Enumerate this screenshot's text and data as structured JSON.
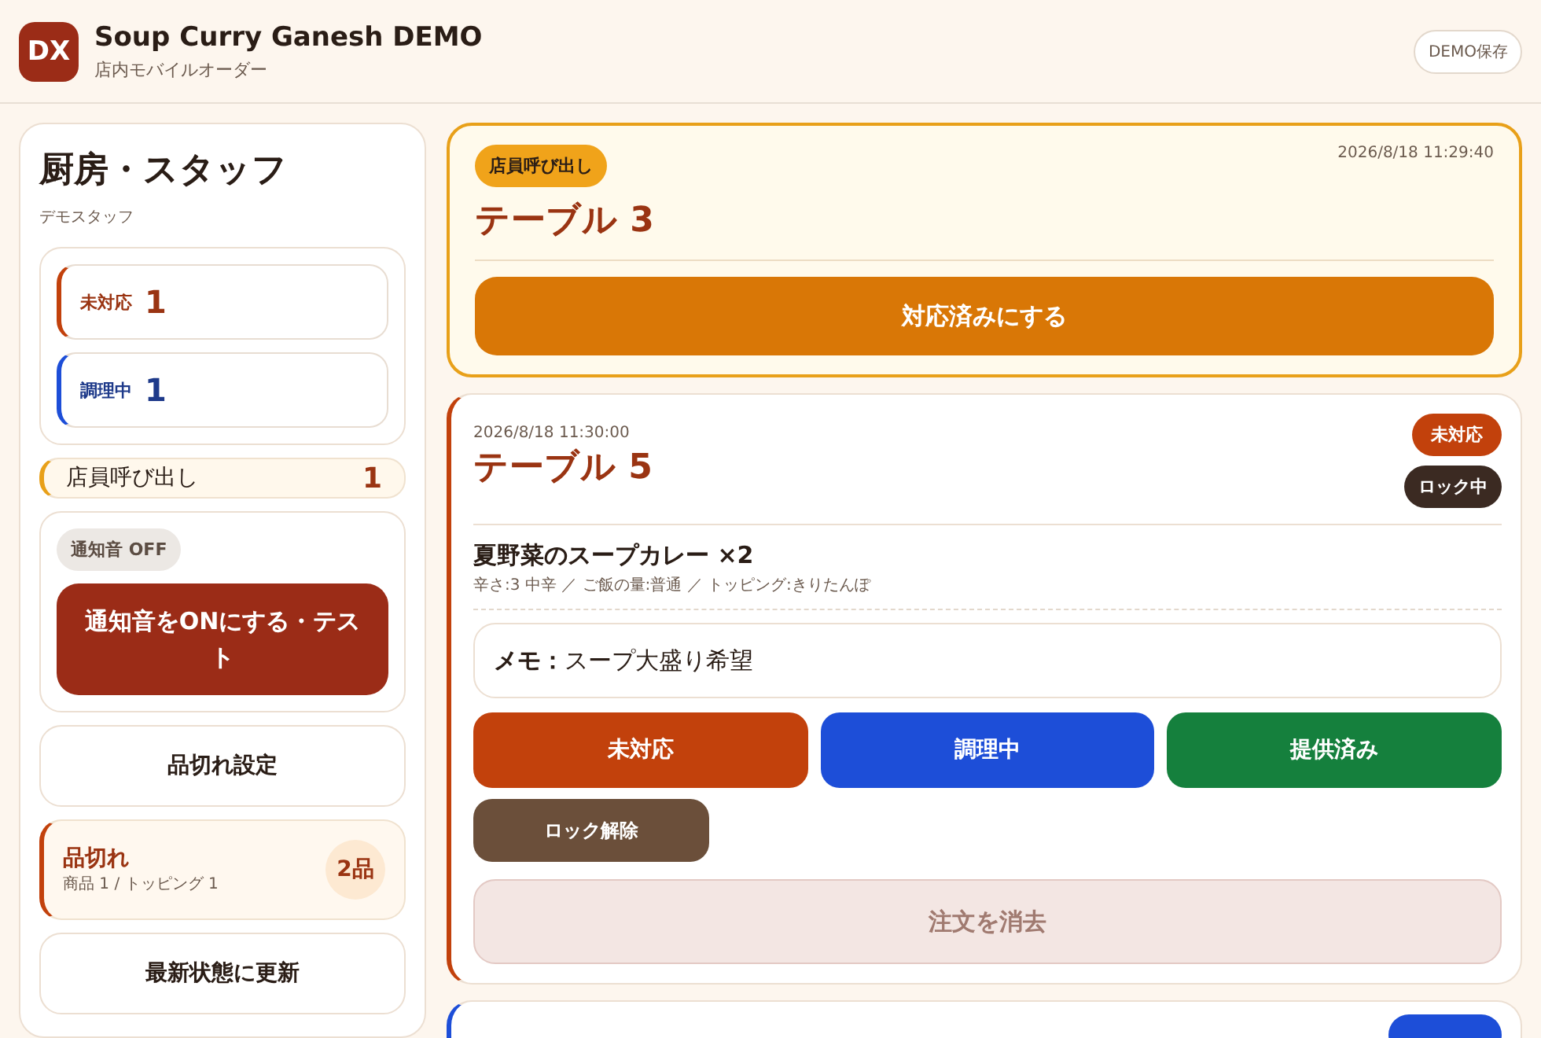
{
  "header": {
    "logo": "DX",
    "title": "Soup Curry Ganesh DEMO",
    "subtitle": "店内モバイルオーダー",
    "save_button": "DEMO保存"
  },
  "sidebar": {
    "title": "厨房・スタッフ",
    "subtitle": "デモスタッフ",
    "counts": [
      {
        "kind": "pending",
        "label": "未対応",
        "value": "1"
      },
      {
        "kind": "cooking",
        "label": "調理中",
        "value": "1"
      }
    ],
    "call_summary": {
      "label": "店員呼び出し",
      "value": "1"
    },
    "notification": {
      "on": false,
      "badge": "通知音 OFF",
      "button": "通知音をONにする・テスト"
    },
    "sold_out_settings_button": "品切れ設定",
    "sold_out": {
      "title": "品切れ",
      "detail": "商品 1 / トッピング 1",
      "count": "2品"
    },
    "refresh_button": "最新状態に更新"
  },
  "orders": [
    {
      "kind": "call",
      "badge": "店員呼び出し",
      "time": "2026/8/18 11:29:40",
      "table": "テーブル 3",
      "action": "対応済みにする"
    },
    {
      "kind": "order",
      "color": "#c2410c",
      "time": "2026/8/18 11:30:00",
      "table": "テーブル 5",
      "status_badge": "未対応",
      "locked": true,
      "lock_badge": "ロック中",
      "items": [
        {
          "name": "夏野菜のスープカレー ×2",
          "options": "辛さ:3 中辛 ／ ご飯の量:普通 ／ トッピング:きりたんぽ"
        }
      ],
      "memo_label": "メモ：",
      "memo": "スープ大盛り希望",
      "status_buttons": [
        {
          "kind": "pending",
          "label": "未対応"
        },
        {
          "kind": "cooking",
          "label": "調理中"
        },
        {
          "kind": "served",
          "label": "提供済み"
        }
      ],
      "unlock_button": "ロック解除",
      "delete_button": "注文を消去"
    },
    {
      "kind": "stub",
      "color": "#1d4ed8"
    }
  ]
}
